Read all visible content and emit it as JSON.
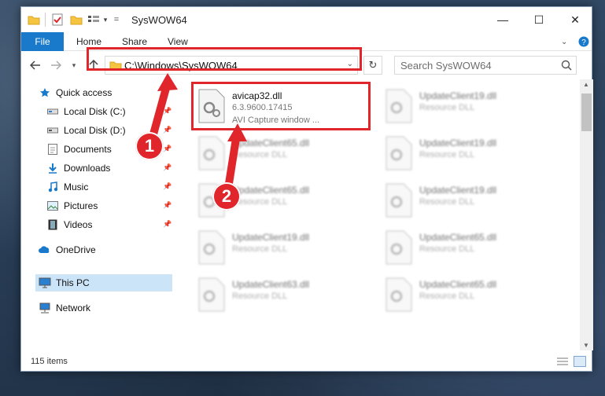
{
  "window": {
    "title": "SysWOW64",
    "minimize": "—",
    "maximize": "☐",
    "close": "✕"
  },
  "ribbon": {
    "tabs": [
      "File",
      "Home",
      "Share",
      "View"
    ]
  },
  "address_bar": {
    "path": "C:\\Windows\\SysWOW64"
  },
  "search": {
    "placeholder": "Search SysWOW64"
  },
  "sidebar": {
    "items": [
      {
        "label": "Quick access",
        "icon": "star-icon",
        "pinned": false
      },
      {
        "label": "Local Disk (C:)",
        "icon": "drive-icon",
        "pinned": true
      },
      {
        "label": "Local Disk (D:)",
        "icon": "drive-icon",
        "pinned": true
      },
      {
        "label": "Documents",
        "icon": "documents-icon",
        "pinned": true
      },
      {
        "label": "Downloads",
        "icon": "downloads-icon",
        "pinned": true
      },
      {
        "label": "Music",
        "icon": "music-icon",
        "pinned": true
      },
      {
        "label": "Pictures",
        "icon": "pictures-icon",
        "pinned": true
      },
      {
        "label": "Videos",
        "icon": "videos-icon",
        "pinned": true
      },
      {
        "label": "OneDrive",
        "icon": "onedrive-icon",
        "pinned": false
      },
      {
        "label": "This PC",
        "icon": "computer-icon",
        "pinned": false,
        "selected": true
      },
      {
        "label": "Network",
        "icon": "network-icon",
        "pinned": false
      }
    ]
  },
  "files": [
    {
      "name": "avicap32.dll",
      "line2": "6.3.9600.17415",
      "line3": "AVI Capture window ...",
      "highlighted": true
    },
    {
      "name": "UpdateClient19.dll",
      "line2": "Resource DLL"
    },
    {
      "name": "UpdateClient65.dll",
      "line2": "Resource DLL"
    },
    {
      "name": "UpdateClient19.dll",
      "line2": "Resource DLL"
    },
    {
      "name": "UpdateClient65.dll",
      "line2": "Resource DLL"
    },
    {
      "name": "UpdateClient19.dll",
      "line2": "Resource DLL"
    },
    {
      "name": "UpdateClient19.dll",
      "line2": "Resource DLL"
    },
    {
      "name": "UpdateClient65.dll",
      "line2": "Resource DLL"
    },
    {
      "name": "UpdateClient63.dll",
      "line2": "Resource DLL"
    },
    {
      "name": "UpdateClient65.dll",
      "line2": "Resource DLL"
    }
  ],
  "status": {
    "item_count": "115 items"
  },
  "annotations": {
    "step1": "1",
    "step2": "2",
    "color": "#e0262b"
  }
}
